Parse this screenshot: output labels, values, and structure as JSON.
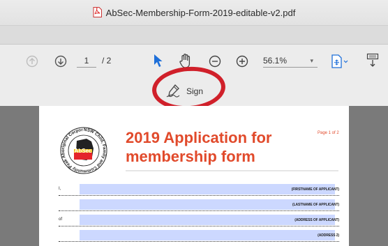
{
  "window": {
    "title": "AbSec-Membership-Form-2019-editable-v2.pdf"
  },
  "toolbar": {
    "current_page": "1",
    "total_pages": "/ 2",
    "zoom": "56.1%",
    "zoom_caret": "▾",
    "sign_label": "Sign"
  },
  "document": {
    "heading_line1": "2019 Application for",
    "heading_line2": "membership form",
    "page_label": "Page 1 of 2",
    "logo_text": "AbSec",
    "logo_ring_text": "NSW Child, Family and Community Peak Aboriginal Corporation",
    "rows": [
      {
        "label": "I,",
        "caption": "(FIRSTNAME OF APPLICANT)"
      },
      {
        "label": "",
        "caption": "(LASTNAME OF APPLICANT)"
      },
      {
        "label": "of",
        "caption": "(ADDRESS OF APPLICANT)"
      },
      {
        "label": "",
        "caption": "(ADDRESS 2)"
      }
    ]
  },
  "colors": {
    "accent_red": "#e14a2b",
    "field_fill": "#ccd8ff",
    "highlight_ring": "#d0202a",
    "toolbar_blue": "#1e6fd9"
  }
}
